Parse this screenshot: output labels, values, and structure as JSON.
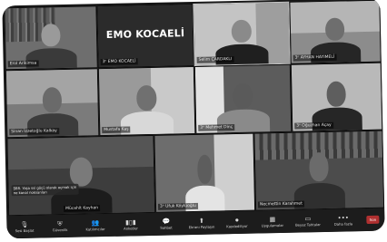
{
  "meeting": {
    "banner_text": "EMO KOCAELİ",
    "chat_message": "ŞBR. Yaşa ssi göçü olarak açmak için ne kanal noksanları"
  },
  "participants": [
    {
      "name": "Erol Arikimsa"
    },
    {
      "name": "3ⁿ EMO KOCAELİ"
    },
    {
      "name": "Selim ÇARDAKLI"
    },
    {
      "name": "3ⁿ AYHAN HAYIMELİ"
    },
    {
      "name": "Sinan İzzetoğlu Kalkay"
    },
    {
      "name": "Mustafa Kaş"
    },
    {
      "name": "3ⁿ Mehmet Dinç"
    },
    {
      "name": "3ⁿ Oğuzhan Açay"
    },
    {
      "name": "Mücahit Kayhan"
    },
    {
      "name": "3ⁿ Ufuk Köylüoğlu"
    },
    {
      "name": "Necmettin Karahmet"
    }
  ],
  "toolbar": {
    "items": [
      {
        "label": "Sesi Başlat",
        "icon": "mic-icon"
      },
      {
        "label": "Güvenlik",
        "icon": "shield-icon"
      },
      {
        "label": "Katılımcılar",
        "icon": "participants-icon"
      },
      {
        "label": "Anketler",
        "icon": "polls-icon"
      },
      {
        "label": "Sohbet",
        "icon": "chat-icon"
      },
      {
        "label": "Ekranı Paylaşın",
        "icon": "share-screen-icon"
      },
      {
        "label": "Kaydediliyor",
        "icon": "record-icon"
      },
      {
        "label": "Uygulamalar",
        "icon": "apps-icon"
      },
      {
        "label": "Beyaz Tahtalar",
        "icon": "whiteboard-icon"
      },
      {
        "label": "Daha fazla",
        "icon": "more-icon"
      }
    ],
    "end_label": "Son"
  }
}
